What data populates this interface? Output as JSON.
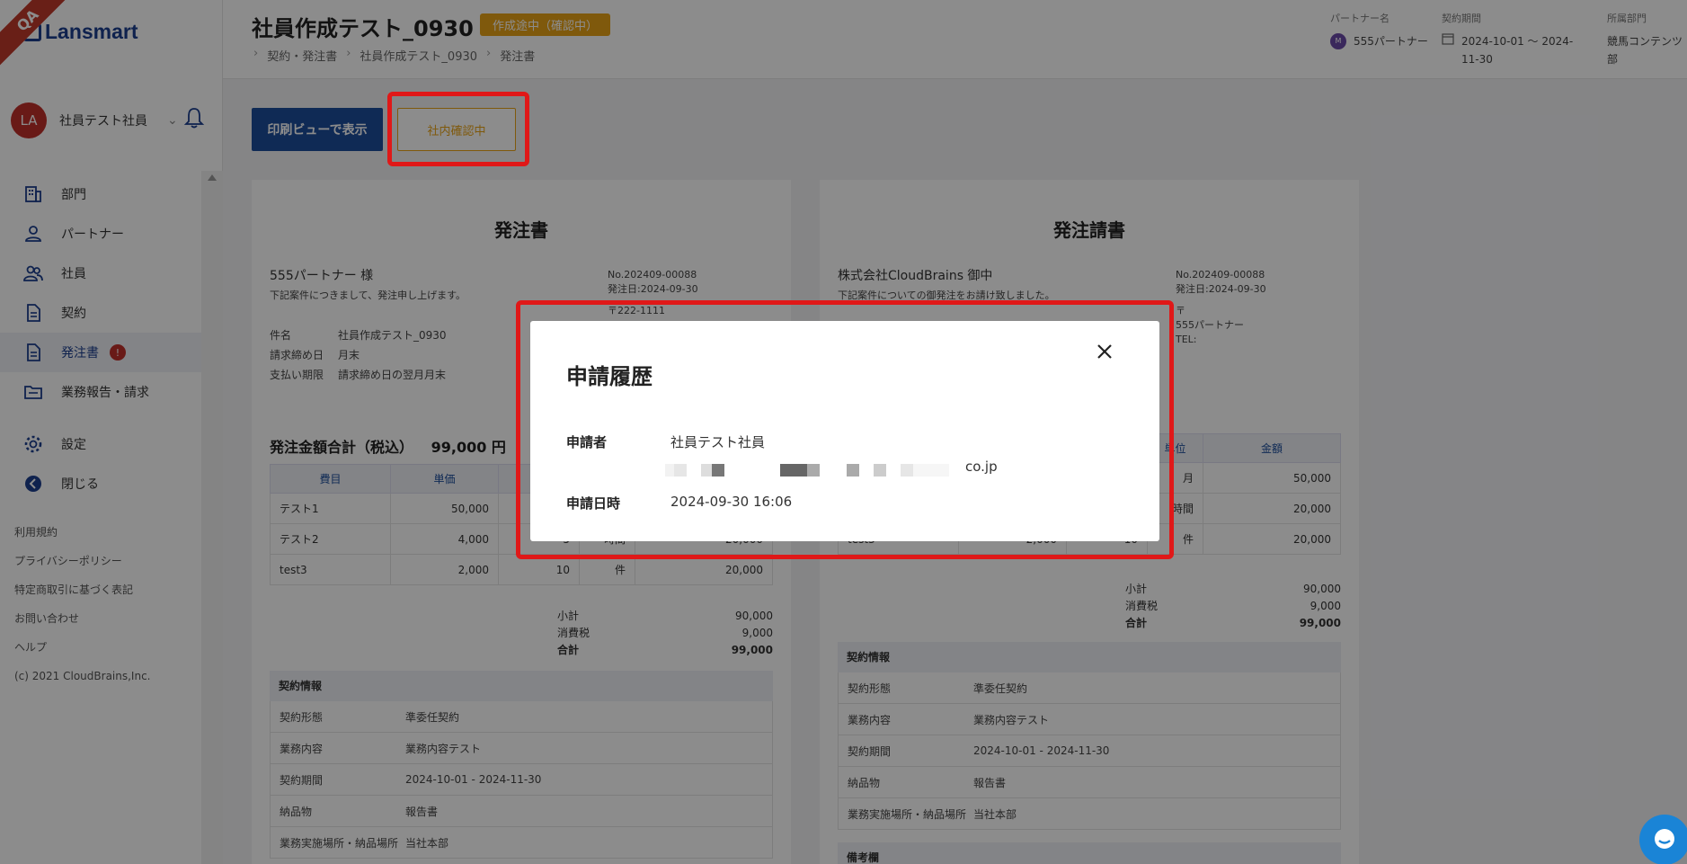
{
  "qa_ribbon": "QA",
  "logo": "Lansmart",
  "user": {
    "initials": "LA",
    "name": "社員テスト社員"
  },
  "nav": {
    "items": [
      {
        "label": "部門",
        "icon": "building-icon"
      },
      {
        "label": "パートナー",
        "icon": "person-icon"
      },
      {
        "label": "社員",
        "icon": "people-icon"
      },
      {
        "label": "契約",
        "icon": "document-icon"
      },
      {
        "label": "発注書",
        "icon": "document-icon",
        "badge": "!"
      },
      {
        "label": "業務報告・請求",
        "icon": "folder-icon"
      },
      {
        "label": "設定",
        "icon": "gear-icon"
      },
      {
        "label": "閉じる",
        "icon": "back-icon"
      }
    ]
  },
  "footer_links": [
    "利用規約",
    "プライバシーポリシー",
    "特定商取引に基づく表記",
    "お問い合わせ",
    "ヘルプ",
    "(c) 2021 CloudBrains,Inc."
  ],
  "header": {
    "title": "社員作成テスト_0930",
    "status": "作成途中（確認中）",
    "breadcrumb": [
      "契約・発注書",
      "社員作成テスト_0930",
      "発注書"
    ],
    "partner_label": "パートナー名",
    "partner_initials": "M",
    "partner_name": "555パートナー",
    "period_label": "契約期間",
    "period_value": "2024-10-01 ～ 2024-11-30",
    "dept_label": "所属部門",
    "dept_value": "競馬コンテンツ部"
  },
  "actions": {
    "print_label": "印刷ビューで表示",
    "confirm_label": "社内確認中"
  },
  "doc_left": {
    "title": "発注書",
    "to": "555パートナー 様",
    "note": "下記案件につきまして、発注申し上げます。",
    "meta": [
      "No.202409-00088",
      "発注日:2024-09-30",
      "〒222-1111"
    ],
    "fields": [
      {
        "k": "件名",
        "v": "社員作成テスト_0930"
      },
      {
        "k": "請求締め日",
        "v": "月末"
      },
      {
        "k": "支払い期限",
        "v": "請求締め日の翌月月末"
      }
    ],
    "total_label": "発注金額合計（税込）",
    "total_value": "99,000 円",
    "headers": [
      "費目",
      "単価",
      "",
      "",
      ""
    ],
    "rows": [
      [
        "テスト1",
        "50,000",
        "",
        "",
        ""
      ],
      [
        "テスト2",
        "4,000",
        "5",
        "時間",
        "20,000"
      ],
      [
        "test3",
        "2,000",
        "10",
        "件",
        "20,000"
      ]
    ],
    "subtotal_label": "小計",
    "subtotal": "90,000",
    "tax_label": "消費税",
    "tax": "9,000",
    "grand_label": "合計",
    "grand": "99,000",
    "contract_title": "契約情報",
    "contract": [
      {
        "k": "契約形態",
        "v": "準委任契約"
      },
      {
        "k": "業務内容",
        "v": "業務内容テスト"
      },
      {
        "k": "契約期間",
        "v": "2024-10-01 - 2024-11-30"
      },
      {
        "k": "納品物",
        "v": "報告書"
      },
      {
        "k": "業務実施場所・納品場所",
        "v": "当社本部"
      }
    ]
  },
  "doc_right": {
    "title": "発注請書",
    "to": "株式会社CloudBrains 御中",
    "note": "下記案件についての御発注をお請け致しました。",
    "meta": [
      "No.202409-00088",
      "発注日:2024-09-30",
      "〒",
      "555パートナー",
      "TEL:"
    ],
    "headers": [
      "",
      "",
      "",
      "単位",
      "金額"
    ],
    "rows": [
      [
        "",
        "",
        "",
        "月",
        "50,000"
      ],
      [
        "",
        "",
        "",
        "時間",
        "20,000"
      ],
      [
        "test3",
        "2,000",
        "10",
        "件",
        "20,000"
      ]
    ],
    "subtotal_label": "小計",
    "subtotal": "90,000",
    "tax_label": "消費税",
    "tax": "9,000",
    "grand_label": "合計",
    "grand": "99,000",
    "contract_title": "契約情報",
    "contract": [
      {
        "k": "契約形態",
        "v": "準委任契約"
      },
      {
        "k": "業務内容",
        "v": "業務内容テスト"
      },
      {
        "k": "契約期間",
        "v": "2024-10-01 - 2024-11-30"
      },
      {
        "k": "納品物",
        "v": "報告書"
      },
      {
        "k": "業務実施場所・納品場所",
        "v": "当社本部"
      }
    ],
    "remarks_title": "備考欄"
  },
  "modal": {
    "title": "申請履歴",
    "applicant_label": "申請者",
    "applicant_name": "社員テスト社員",
    "email_suffix": "co.jp",
    "date_label": "申請日時",
    "date_value": "2024-09-30 16:06"
  },
  "colors": {
    "brand": "#1d3f8f",
    "primary_button": "#1d4d9b",
    "accent": "#e8a317",
    "alert": "#c0302a",
    "highlight": "#e01818"
  }
}
